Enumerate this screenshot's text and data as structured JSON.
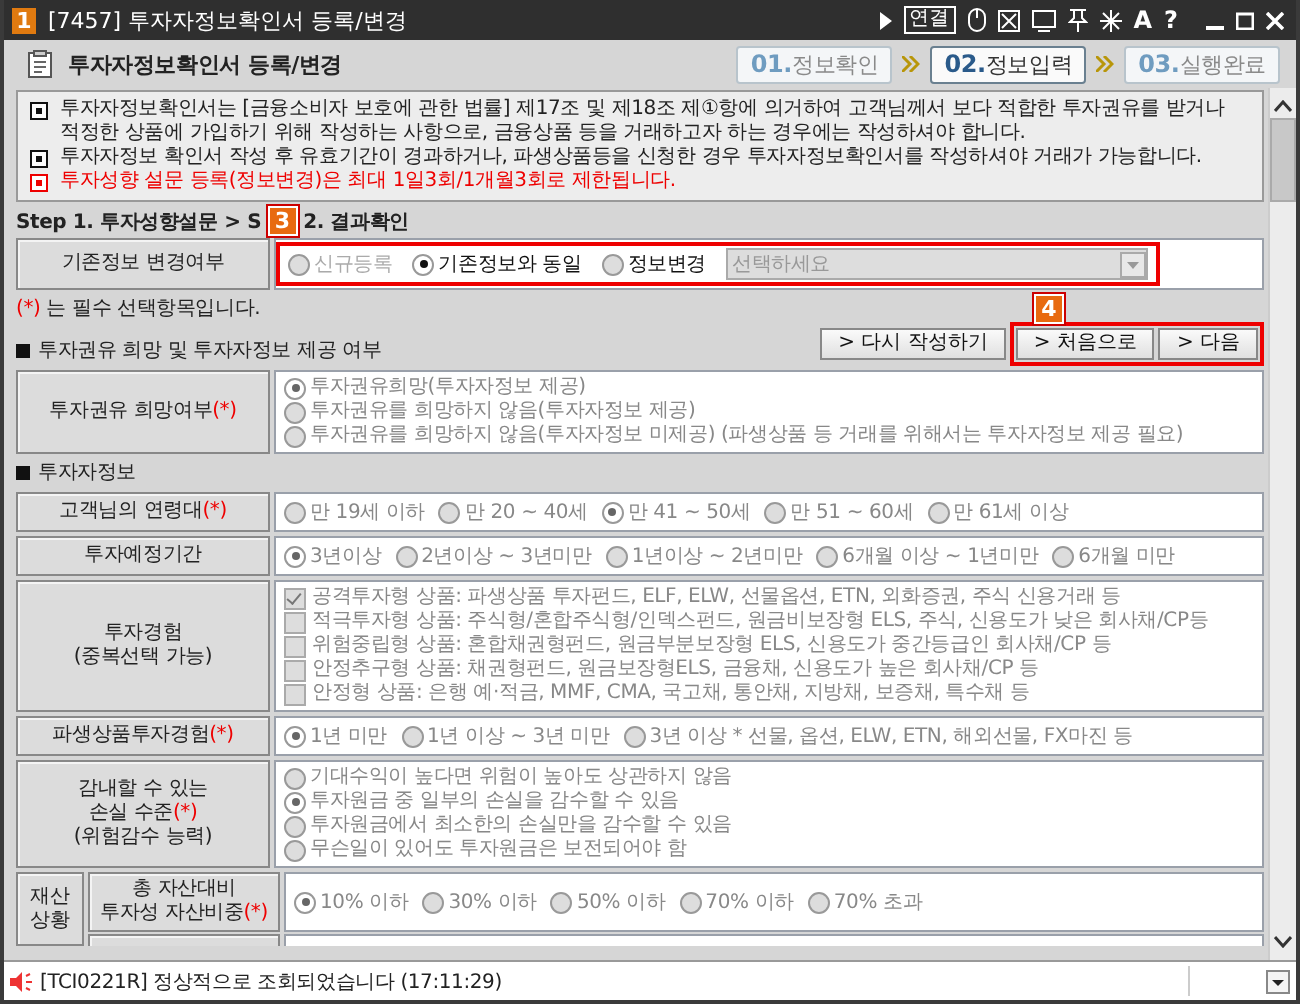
{
  "window": {
    "badge": "1",
    "title": "[7457] 투자자정보확인서 등록/변경",
    "connect": "연결",
    "glyphs": [
      "A",
      "?"
    ]
  },
  "header": {
    "title": "투자자정보확인서 등록/변경",
    "steps": [
      {
        "num": "01.",
        "label": "정보확인",
        "selected": false
      },
      {
        "num": "02.",
        "label": "정보입력",
        "selected": true
      },
      {
        "num": "03.",
        "label": "실행완료",
        "selected": false
      }
    ]
  },
  "notices": [
    {
      "kind": "info",
      "text": "투자자정보확인서는 [금융소비자 보호에 관한 법률] 제17조 및 제18조 제①항에 의거하여 고객님께서 보다 적합한 투자권유를 받거나 적정한 상품에 가입하기 위해 작성하는 사항으로, 금융상품 등을 거래하고자 하는 경우에는 작성하셔야 합니다."
    },
    {
      "kind": "info",
      "text": "투자자정보 확인서 작성 후 유효기간이 경과하거나, 파생상품등을 신청한 경우 투자자정보확인서를 작성하셔야 거래가 가능합니다."
    },
    {
      "kind": "warning",
      "text": "투자성향 설문 등록(정보변경)은 최대 1일3회/1개월3회로 제한됩니다."
    }
  ],
  "steps_line": {
    "before": "Step 1. 투자성향설문 > S",
    "badge": "3",
    "after": "2. 결과확인"
  },
  "change_row": {
    "label": "기존정보 변경여부",
    "options": [
      {
        "text": "신규등록",
        "selected": false,
        "disabled": true
      },
      {
        "text": "기존정보와 동일",
        "selected": true,
        "disabled": false
      },
      {
        "text": "정보변경",
        "selected": false,
        "disabled": false
      }
    ],
    "select": {
      "placeholder": "선택하세요",
      "disabled": true
    }
  },
  "required_note": {
    "mark": "(*)",
    "text": "는 필수 선택항목입니다."
  },
  "sections": [
    {
      "title": "투자권유 희망 및 투자자정보 제공 여부",
      "actions": [
        {
          "label": "> 다시 작성하기"
        }
      ],
      "highlighted_actions": {
        "badge": "4",
        "items": [
          {
            "label": "> 처음으로"
          },
          {
            "label": "> 다음"
          }
        ]
      },
      "questions": [
        {
          "kind": "radio-list",
          "label_lines": [
            "투자권유 희망여부"
          ],
          "mark": "(*)",
          "disabled": true,
          "options": [
            {
              "text": "투자권유희망(투자자정보 제공)",
              "selected": true
            },
            {
              "text": "투자권유를 희망하지 않음(투자자정보 제공)",
              "selected": false
            },
            {
              "text": "투자권유를 희망하지 않음(투자자정보 미제공)  (파생상품 등 거래를 위해서는 투자자정보 제공 필요)",
              "selected": false
            }
          ]
        }
      ]
    },
    {
      "title": "투자자정보",
      "questions": [
        {
          "kind": "radio-row",
          "label_lines": [
            "고객님의 연령대"
          ],
          "mark": "(*)",
          "disabled": true,
          "options": [
            {
              "text": "만 19세 이하",
              "selected": false
            },
            {
              "text": "만 20 ~ 40세",
              "selected": false
            },
            {
              "text": "만 41 ~ 50세",
              "selected": true
            },
            {
              "text": "만 51 ~ 60세",
              "selected": false
            },
            {
              "text": "만 61세 이상",
              "selected": false
            }
          ]
        },
        {
          "kind": "radio-row",
          "label_lines": [
            "투자예정기간"
          ],
          "disabled": true,
          "options": [
            {
              "text": "3년이상",
              "selected": true
            },
            {
              "text": "2년이상 ~ 3년미만",
              "selected": false
            },
            {
              "text": "1년이상 ~ 2년미만",
              "selected": false
            },
            {
              "text": "6개월 이상 ~ 1년미만",
              "selected": false
            },
            {
              "text": "6개월 미만",
              "selected": false
            }
          ]
        },
        {
          "kind": "checkbox-list",
          "label_lines": [
            "투자경험"
          ],
          "note": "(중복선택 가능)",
          "disabled": true,
          "options": [
            {
              "text": "공격투자형 상품: 파생상품 투자펀드, ELF, ELW, 선물옵션, ETN, 외화증권, 주식 신용거래 등",
              "selected": true
            },
            {
              "text": "적극투자형 상품: 주식형/혼합주식형/인덱스펀드, 원금비보장형 ELS, 주식, 신용도가 낮은 회사채/CP등",
              "selected": false
            },
            {
              "text": "위험중립형 상품: 혼합채권형펀드, 원금부분보장형 ELS, 신용도가 중간등급인 회사채/CP 등",
              "selected": false
            },
            {
              "text": "안정추구형 상품: 채권형펀드, 원금보장형ELS, 금융채, 신용도가 높은 회사채/CP 등",
              "selected": false
            },
            {
              "text": "안정형 상품: 은행 예·적금, MMF, CMA, 국고채, 통안채, 지방채, 보증채, 특수채 등",
              "selected": false
            }
          ]
        },
        {
          "kind": "radio-row",
          "label_lines": [
            "파생상품투자경험"
          ],
          "mark": "(*)",
          "disabled": true,
          "options": [
            {
              "text": "1년 미만",
              "selected": true
            },
            {
              "text": "1년 이상 ~ 3년 미만",
              "selected": false
            },
            {
              "text": "3년 이상 * 선물, 옵션, ELW, ETN, 해외선물, FX마진 등",
              "selected": false
            }
          ]
        },
        {
          "kind": "radio-list",
          "label_lines": [
            "감내할 수 있는",
            "손실 수준"
          ],
          "mark": "(*)",
          "note": "(위험감수 능력)",
          "disabled": true,
          "options": [
            {
              "text": "기대수익이 높다면 위험이 높아도 상관하지 않음",
              "selected": false
            },
            {
              "text": "투자원금 중 일부의 손실을 감수할 수 있음",
              "selected": true
            },
            {
              "text": "투자원금에서 최소한의 손실만을 감수할 수 있음",
              "selected": false
            },
            {
              "text": "무슨일이 있어도 투자원금은 보전되어야 함",
              "selected": false
            }
          ]
        }
      ],
      "group": {
        "label": "재산상황",
        "questions": [
          {
            "kind": "radio-row",
            "label_lines": [
              "총 자산대비",
              "투자성 자산비중"
            ],
            "mark": "(*)",
            "disabled": true,
            "options": [
              {
                "text": "10% 이하",
                "selected": true
              },
              {
                "text": "30% 이하",
                "selected": false
              },
              {
                "text": "50% 이하",
                "selected": false
              },
              {
                "text": "70% 이하",
                "selected": false
              },
              {
                "text": "70% 초과",
                "selected": false
              }
            ]
          }
        ]
      }
    }
  ],
  "status_bar": {
    "message": "[TCI0221R] 정상적으로 조회되었습니다 (17:11:29)"
  }
}
